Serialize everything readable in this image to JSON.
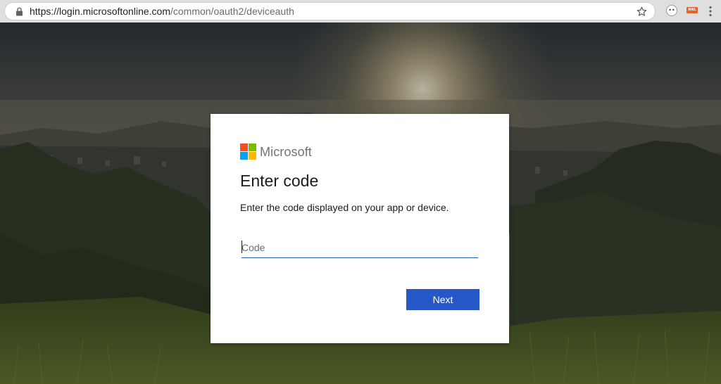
{
  "browser": {
    "url_host": "https://login.microsoftonline.com",
    "url_path": "/common/oauth2/deviceauth",
    "lock_icon": "lock-icon",
    "star_icon": "star-icon",
    "extension_one_text": "••",
    "extension_two_text": "NNL",
    "menu_icon": "kebab-menu-icon"
  },
  "card": {
    "logo_text": "Microsoft",
    "title": "Enter code",
    "description": "Enter the code displayed on your app or device.",
    "code_input": {
      "value": "",
      "placeholder": "Code"
    },
    "next_label": "Next"
  },
  "colors": {
    "ms_red": "#f25022",
    "ms_green": "#7fba00",
    "ms_blue": "#00a4ef",
    "ms_yellow": "#ffb900",
    "primary_button": "#2657c6",
    "input_underline": "#2b59c3"
  }
}
